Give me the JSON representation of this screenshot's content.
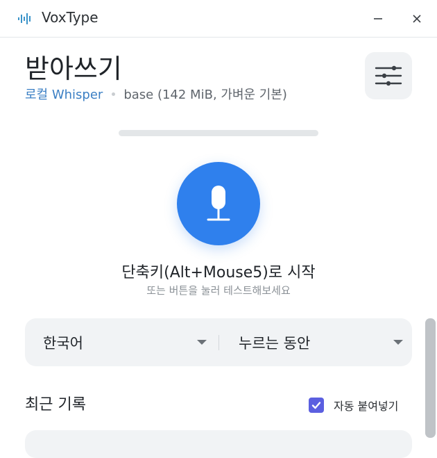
{
  "window": {
    "app_title": "VoxType",
    "icons": {
      "app": "waveform-icon",
      "minimize": "minimize-icon",
      "close": "close-icon"
    }
  },
  "header": {
    "page_title": "받아쓰기",
    "engine": "로컬 Whisper",
    "model": "base (142 MiB, 가벼운 기본)",
    "settings_icon": "sliders-icon"
  },
  "recorder": {
    "level": 0,
    "mic_icon": "microphone-icon",
    "shortcut_text": "단축키(Alt+Mouse5)로 시작",
    "hint_text": "또는 버튼을 눌러 테스트해보세요"
  },
  "selectors": {
    "language": {
      "value": "한국어"
    },
    "mode": {
      "value": "누르는 동안"
    }
  },
  "recent": {
    "title": "최근 기록",
    "autopaste_label": "자동 붙여넣기",
    "autopaste_checked": true
  },
  "colors": {
    "accent": "#2f80ed",
    "engine_link": "#3b7fc4",
    "checkbox": "#5b5fe0"
  }
}
